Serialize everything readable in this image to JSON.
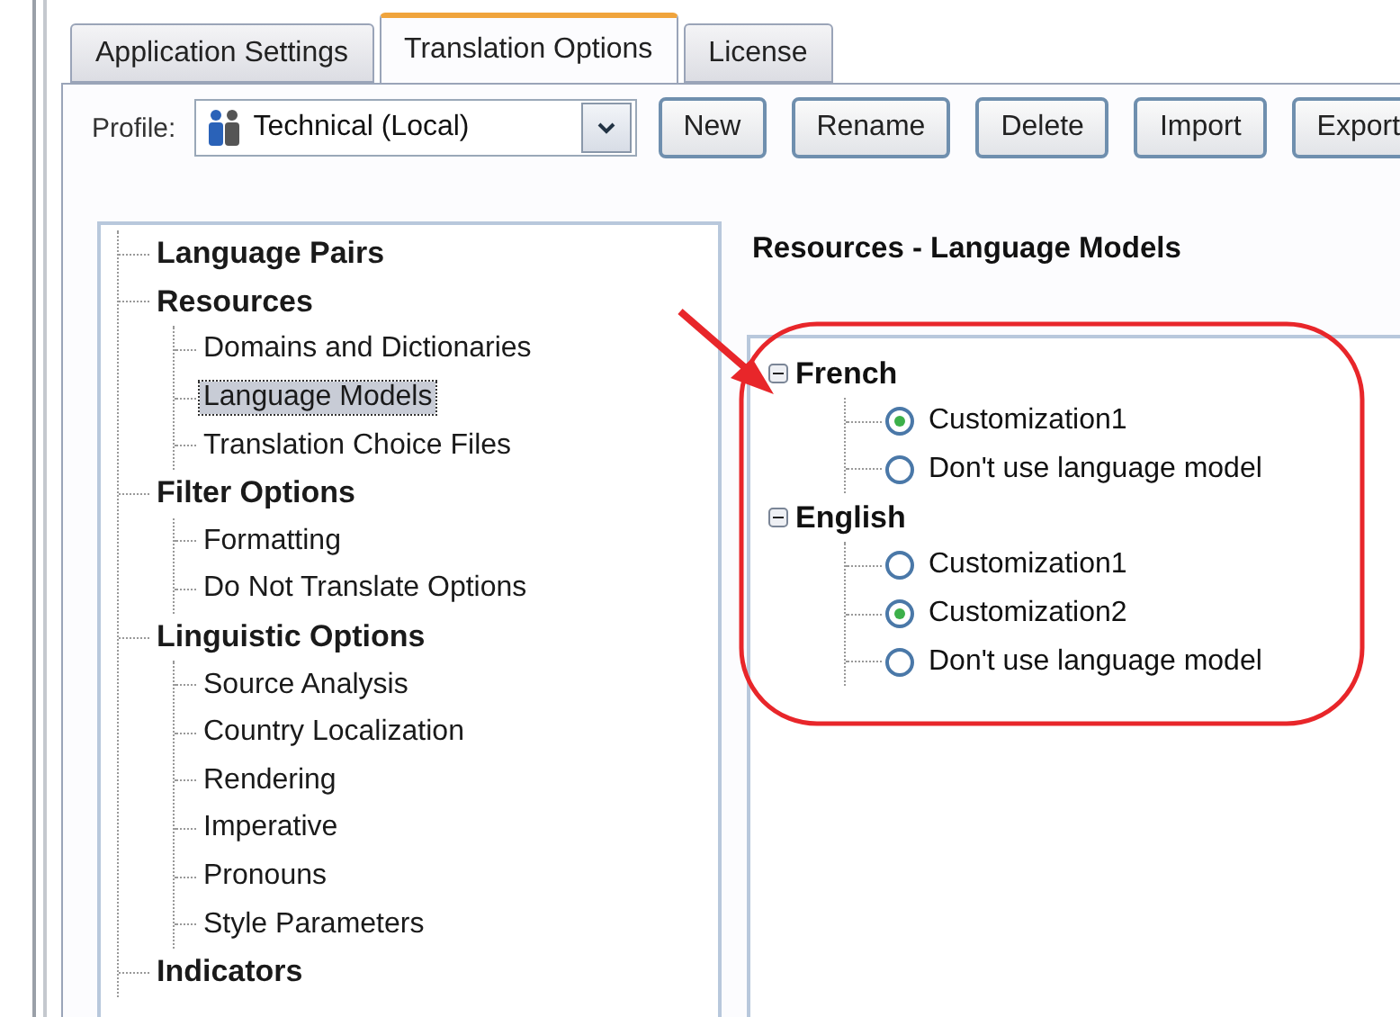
{
  "tabs": [
    {
      "label": "Application Settings",
      "selected": false
    },
    {
      "label": "Translation Options",
      "selected": true
    },
    {
      "label": "License",
      "selected": false
    }
  ],
  "profile": {
    "label": "Profile:",
    "value": "Technical (Local)"
  },
  "buttons": [
    "New",
    "Rename",
    "Delete",
    "Import",
    "Export"
  ],
  "tree": [
    {
      "label": "Language Pairs",
      "selected": false
    },
    {
      "label": "Resources",
      "selected": false,
      "children": [
        {
          "label": "Domains and Dictionaries",
          "selected": false
        },
        {
          "label": "Language Models",
          "selected": true
        },
        {
          "label": "Translation Choice Files",
          "selected": false
        }
      ]
    },
    {
      "label": "Filter Options",
      "selected": false,
      "children": [
        {
          "label": "Formatting",
          "selected": false
        },
        {
          "label": "Do Not Translate Options",
          "selected": false
        }
      ]
    },
    {
      "label": "Linguistic Options",
      "selected": false,
      "children": [
        {
          "label": "Source Analysis",
          "selected": false
        },
        {
          "label": "Country Localization",
          "selected": false
        },
        {
          "label": "Rendering",
          "selected": false
        },
        {
          "label": "Imperative",
          "selected": false
        },
        {
          "label": "Pronouns",
          "selected": false
        },
        {
          "label": "Style Parameters",
          "selected": false
        }
      ]
    },
    {
      "label": "Indicators",
      "selected": false
    }
  ],
  "panel": {
    "title": "Resources - Language Models",
    "languages": [
      {
        "name": "French",
        "expanded": true,
        "options": [
          {
            "label": "Customization1",
            "selected": true
          },
          {
            "label": "Don't use language model",
            "selected": false
          }
        ]
      },
      {
        "name": "English",
        "expanded": true,
        "options": [
          {
            "label": "Customization1",
            "selected": false
          },
          {
            "label": "Customization2",
            "selected": true
          },
          {
            "label": "Don't use language model",
            "selected": false
          }
        ]
      }
    ]
  }
}
